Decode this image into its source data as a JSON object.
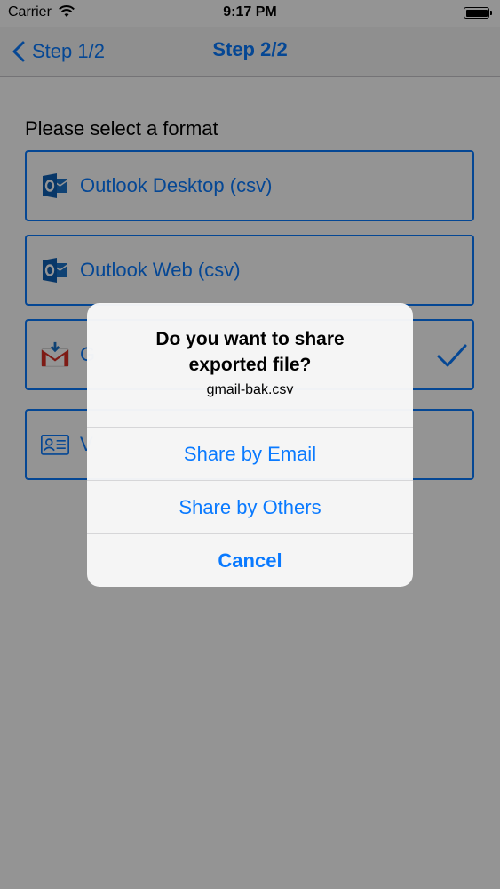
{
  "status_bar": {
    "carrier": "Carrier",
    "time": "9:17 PM"
  },
  "nav": {
    "back_label": "Step 1/2",
    "title": "Step 2/2"
  },
  "content": {
    "prompt": "Please select a format",
    "options": [
      {
        "label": "Outlook Desktop (csv)",
        "icon": "outlook-icon"
      },
      {
        "label": "Outlook Web (csv)",
        "icon": "outlook-icon"
      },
      {
        "label": "G",
        "icon": "gmail-icon",
        "selected": true
      },
      {
        "label": "V",
        "icon": "vcard-icon"
      }
    ]
  },
  "alert": {
    "title_line1": "Do you want to share",
    "title_line2": "exported file?",
    "message": "gmail-bak.csv",
    "buttons": [
      "Share by Email",
      "Share by Others",
      "Cancel"
    ]
  },
  "colors": {
    "accent": "#0a7aff",
    "outlook_blue": "#0f5fb3",
    "gmail_red": "#d93025",
    "overlay": "rgba(0,0,0,0.42)"
  }
}
